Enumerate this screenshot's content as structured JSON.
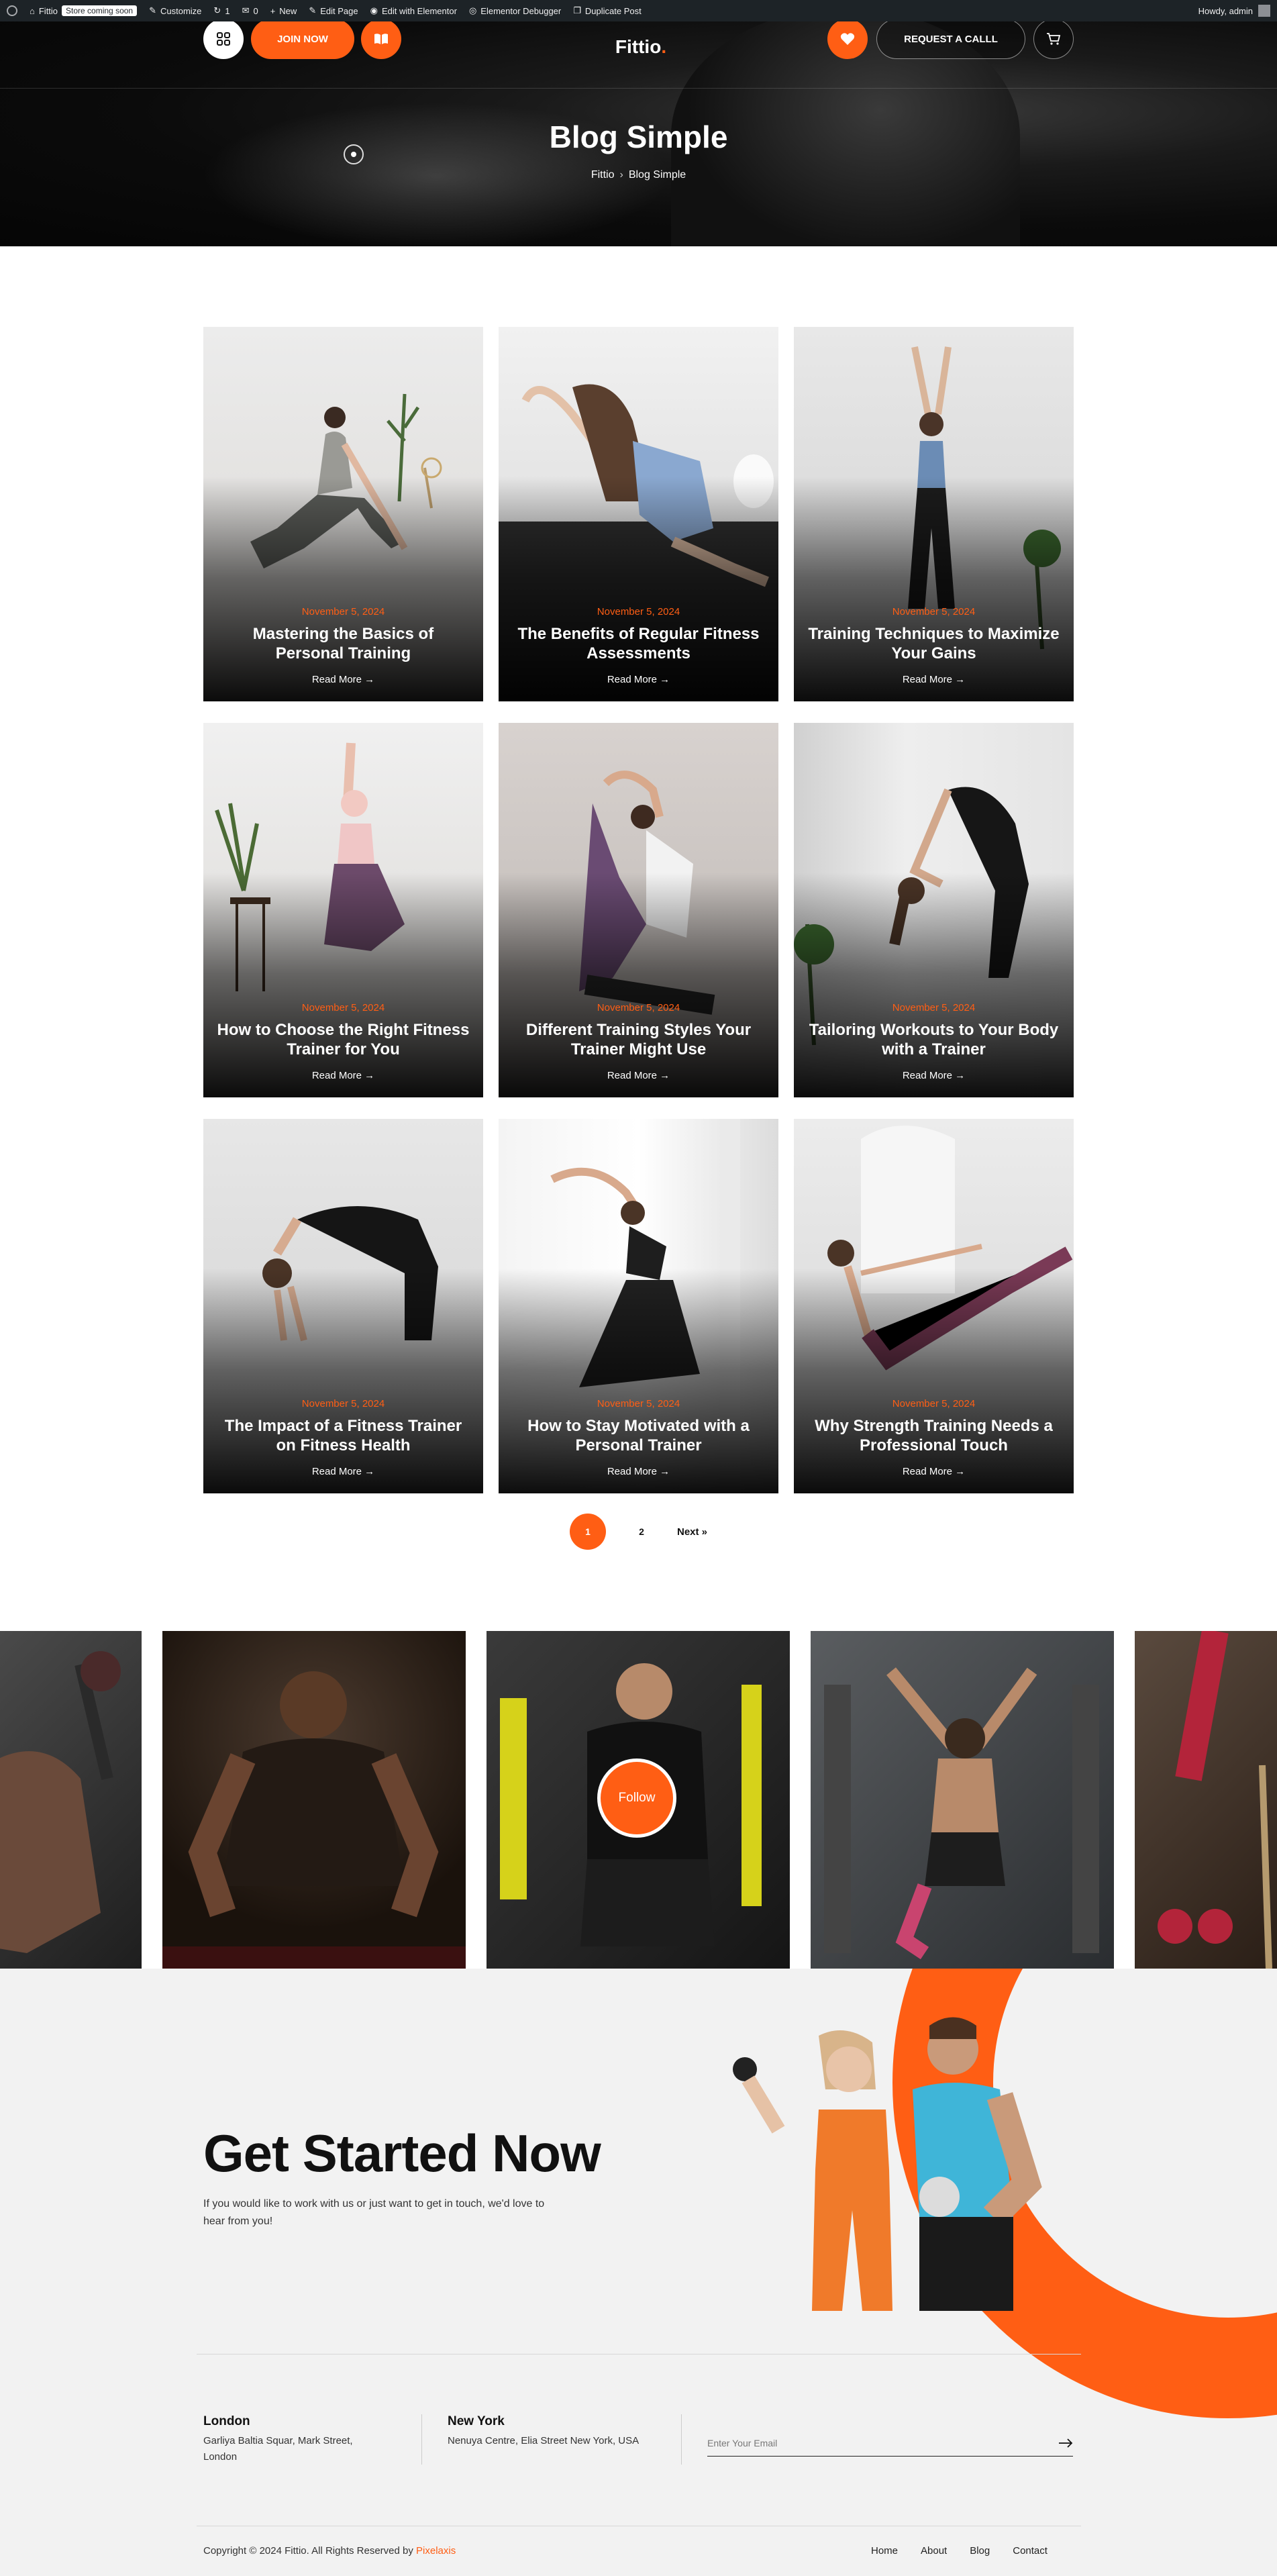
{
  "admin_bar": {
    "site_name": "Fittio",
    "store_badge": "Store coming soon",
    "customize": "Customize",
    "updates_count": "1",
    "comments_count": "0",
    "new": "New",
    "edit_page": "Edit Page",
    "edit_elementor": "Edit with Elementor",
    "elementor_debugger": "Elementor Debugger",
    "duplicate_post": "Duplicate Post",
    "howdy": "Howdy, admin"
  },
  "header": {
    "join_label": "JOIN NOW",
    "logo_text": "Fittio",
    "logo_dot": ".",
    "request_call": "REQUEST A CALLL"
  },
  "hero": {
    "title": "Blog Simple",
    "breadcrumb": [
      "Fittio",
      "Blog Simple"
    ]
  },
  "posts": [
    {
      "date": "November 5, 2024",
      "title": "Mastering the Basics of Personal Training",
      "more": "Read More →"
    },
    {
      "date": "November 5, 2024",
      "title": "The Benefits of Regular Fitness Assessments",
      "more": "Read More →"
    },
    {
      "date": "November 5, 2024",
      "title": "Training Techniques to Maximize Your Gains",
      "more": "Read More →"
    },
    {
      "date": "November 5, 2024",
      "title": "How to Choose the Right Fitness Trainer for You",
      "more": "Read More →"
    },
    {
      "date": "November 5, 2024",
      "title": "Different Training Styles Your Trainer Might Use",
      "more": "Read More →"
    },
    {
      "date": "November 5, 2024",
      "title": "Tailoring Workouts to Your Body with a Trainer",
      "more": "Read More →"
    },
    {
      "date": "November 5, 2024",
      "title": "The Impact of a Fitness Trainer on Fitness Health",
      "more": "Read More →"
    },
    {
      "date": "November 5, 2024",
      "title": "How to Stay Motivated with a Personal Trainer",
      "more": "Read More →"
    },
    {
      "date": "November 5, 2024",
      "title": "Why Strength Training Needs a Professional Touch",
      "more": "Read More →"
    }
  ],
  "pagination": {
    "current": "1",
    "page2": "2",
    "next": "Next »"
  },
  "instagram": {
    "follow": "Follow"
  },
  "cta": {
    "title": "Get Started Now",
    "lead": "If you would like to work with us or just want to get in touch, we'd love to hear from you!"
  },
  "offices": [
    {
      "city": "London",
      "address": "Garliya Baltia Squar, Mark Street, London"
    },
    {
      "city": "New York",
      "address": "Nenuya Centre, Elia Street New York, USA"
    }
  ],
  "newsletter": {
    "placeholder": "Enter Your Email"
  },
  "footer": {
    "copyright": "Copyright © 2024 Fittio. All Rights Reserved by ",
    "brand": "Pixelaxis",
    "nav": [
      "Home",
      "About",
      "Blog",
      "Contact"
    ]
  },
  "colors": {
    "accent": "#ff5e14",
    "dark": "#0b0b0b",
    "admin_bar": "#1d2327"
  }
}
